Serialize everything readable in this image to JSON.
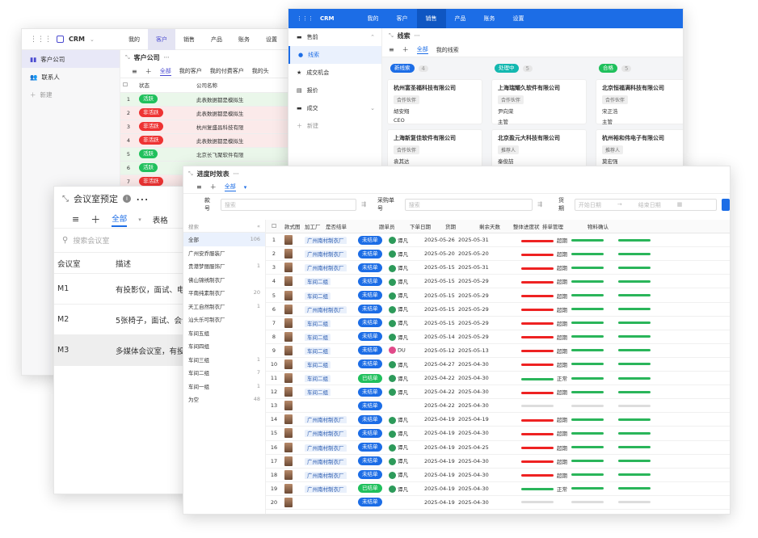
{
  "w1": {
    "app": "CRM",
    "menu": [
      "我的",
      "客户",
      "销售",
      "产品",
      "账务",
      "设置"
    ],
    "side": [
      "客户公司",
      "联系人",
      "新建"
    ],
    "title": "客户公司",
    "tabs": [
      "全部",
      "我的客户",
      "我的付费客户",
      "我的头"
    ],
    "cols": [
      "状态",
      "公司名称"
    ],
    "rows": [
      [
        "1",
        "活跃",
        "此表数据都是模拟生"
      ],
      [
        "2",
        "非活跃",
        "此表数据都是模拟生"
      ],
      [
        "3",
        "非活跃",
        "杭州复盛昌科技有限"
      ],
      [
        "4",
        "非活跃",
        "此表数据都是模拟生"
      ],
      [
        "5",
        "活跃",
        "北京长飞聚软件有限"
      ],
      [
        "6",
        "活跃",
        "此表数据都是模拟生"
      ],
      [
        "7",
        "非活跃",
        ""
      ]
    ]
  },
  "w2": {
    "app": "CRM",
    "menu": [
      "我的",
      "客户",
      "销售",
      "产品",
      "账务",
      "设置"
    ],
    "side": [
      "售前",
      "线索",
      "成交机会",
      "报价",
      "成交",
      "新建"
    ],
    "title": "线索",
    "tabs": [
      "全部",
      "我的线索"
    ],
    "cols": [
      {
        "name": "新线索",
        "count": "4",
        "color": "#1c6de6"
      },
      {
        "name": "处理中",
        "count": "5",
        "color": "#14b8b0"
      },
      {
        "name": "合格",
        "count": "5",
        "color": "#20c05c"
      }
    ],
    "cards": [
      [
        "杭州富圣福科技有限公司",
        "合作伙伴",
        "胡安翔",
        "CEO"
      ],
      [
        "上海瑞耀久软件有限公司",
        "合作伙伴",
        "尹向荣",
        "主管"
      ],
      [
        "北京恒福满科技有限公司",
        "合作伙伴",
        "宋正浩",
        "主管"
      ],
      [
        "上海新复佳软件有限公司",
        "合作伙伴",
        "袁其达",
        ""
      ],
      [
        "北京盈元大科技有限公司",
        "推荐人",
        "秦俊喆",
        ""
      ],
      [
        "杭州裕和伟电子有限公司",
        "推荐人",
        "莫宏强",
        ""
      ]
    ]
  },
  "w3": {
    "title": "会议室预定",
    "tabs": [
      "全部",
      "表格"
    ],
    "search": "搜索会议室",
    "cols": [
      "会议室",
      "描述"
    ],
    "rows": [
      [
        "M1",
        "有投影仪，面试、电"
      ],
      [
        "M2",
        "5张椅子，面试、会议"
      ],
      [
        "M3",
        "多媒体会议室，有投"
      ]
    ]
  },
  "w4": {
    "title": "进度时效表",
    "tab": "全部",
    "filters": {
      "f1": "款号",
      "p1": "搜索",
      "f2": "采购单号",
      "p2": "搜索",
      "f3": "货期",
      "p3": "开始日期",
      "p4": "结束日期",
      "sep": "→"
    },
    "listSearch": "搜索",
    "list": [
      [
        "全部",
        "106"
      ],
      [
        "广州安乔服装厂",
        ""
      ],
      [
        "贵港梦丽服饰厂",
        "1"
      ],
      [
        "佛山锦绣制衣厂",
        ""
      ],
      [
        "平南纯素制衣厂",
        "20"
      ],
      [
        "天工自然制衣厂",
        "1"
      ],
      [
        "汕头乐可制衣厂",
        ""
      ],
      [
        "车间五组",
        ""
      ],
      [
        "车间四组",
        ""
      ],
      [
        "车间三组",
        "1"
      ],
      [
        "车间二组",
        "7"
      ],
      [
        "车间一组",
        "1"
      ],
      [
        "为空",
        "48"
      ]
    ],
    "cols": [
      "",
      "款式图",
      "加工厂",
      "是否结单",
      "跟单员",
      "下单日期",
      "货期",
      "剩余天数",
      "整体进度状态",
      "排单管理",
      "物料确认"
    ],
    "rows": [
      [
        "1",
        "广州南村制衣厂",
        "未结单",
        "谭凡",
        "2025-05-26",
        "2025-05-31",
        "超期",
        "r"
      ],
      [
        "2",
        "广州南村制衣厂",
        "未结单",
        "谭凡",
        "2025-05-20",
        "2025-05-20",
        "超期",
        "r"
      ],
      [
        "3",
        "广州南村制衣厂",
        "未结单",
        "谭凡",
        "2025-05-15",
        "2025-05-31",
        "超期",
        "r"
      ],
      [
        "4",
        "车间二组",
        "未结单",
        "谭凡",
        "2025-05-15",
        "2025-05-29",
        "超期",
        "r"
      ],
      [
        "5",
        "车间二组",
        "未结单",
        "谭凡",
        "2025-05-15",
        "2025-05-29",
        "超期",
        "r"
      ],
      [
        "6",
        "广州南村制衣厂",
        "未结单",
        "谭凡",
        "2025-05-15",
        "2025-05-29",
        "超期",
        "r"
      ],
      [
        "7",
        "车间二组",
        "未结单",
        "谭凡",
        "2025-05-15",
        "2025-05-29",
        "超期",
        "r"
      ],
      [
        "8",
        "车间二组",
        "未结单",
        "谭凡",
        "2025-05-14",
        "2025-05-29",
        "超期",
        "r"
      ],
      [
        "9",
        "车间二组",
        "未结单",
        "DU",
        "2025-05-12",
        "2025-05-13",
        "超期",
        "r"
      ],
      [
        "10",
        "车间二组",
        "未结单",
        "谭凡",
        "2025-04-27",
        "2025-04-30",
        "超期",
        "r"
      ],
      [
        "11",
        "车间二组",
        "已结单",
        "谭凡",
        "2025-04-22",
        "2025-04-30",
        "正常",
        "g"
      ],
      [
        "12",
        "车间二组",
        "未结单",
        "谭凡",
        "2025-04-22",
        "2025-04-30",
        "超期",
        "r"
      ],
      [
        "13",
        "",
        "未结单",
        "",
        "2025-04-22",
        "2025-04-30",
        "",
        "e"
      ],
      [
        "14",
        "广州南村制衣厂",
        "未结单",
        "谭凡",
        "2025-04-19",
        "2025-04-19",
        "超期",
        "r"
      ],
      [
        "15",
        "广州南村制衣厂",
        "未结单",
        "谭凡",
        "2025-04-19",
        "2025-04-30",
        "超期",
        "r"
      ],
      [
        "16",
        "广州南村制衣厂",
        "未结单",
        "谭凡",
        "2025-04-19",
        "2025-04-25",
        "超期",
        "r"
      ],
      [
        "17",
        "广州南村制衣厂",
        "未结单",
        "谭凡",
        "2025-04-19",
        "2025-04-30",
        "超期",
        "r"
      ],
      [
        "18",
        "广州南村制衣厂",
        "未结单",
        "谭凡",
        "2025-04-19",
        "2025-04-30",
        "超期",
        "r"
      ],
      [
        "19",
        "广州南村制衣厂",
        "已结单",
        "谭凡",
        "2025-04-19",
        "2025-04-30",
        "正常",
        "g"
      ],
      [
        "20",
        "",
        "未结单",
        "",
        "2025-04-19",
        "2025-04-30",
        "",
        "e"
      ]
    ]
  }
}
